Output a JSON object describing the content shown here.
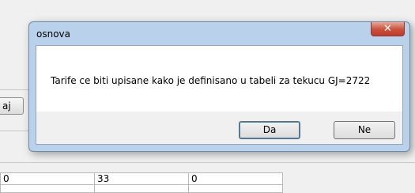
{
  "background": {
    "button_label": "aj",
    "grid_rows": [
      [
        "0",
        "33",
        "0"
      ]
    ]
  },
  "dialog": {
    "title": "osnova",
    "close_glyph": "✕",
    "message": "Tarife ce biti upisane kako je definisano u tabeli za tekucu GJ=2722",
    "buttons": {
      "yes": "Da",
      "no": "Ne"
    }
  }
}
